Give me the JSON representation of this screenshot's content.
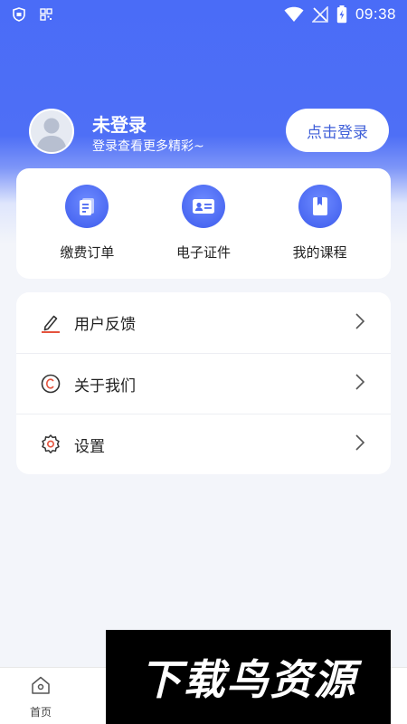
{
  "status_bar": {
    "time": "09:38",
    "icons": [
      "shield-icon",
      "qr-icon",
      "wifi-icon",
      "no-signal-icon",
      "battery-charging-icon"
    ]
  },
  "profile": {
    "name": "未登录",
    "subtitle": "登录查看更多精彩~",
    "login_button": "点击登录"
  },
  "quick_actions": [
    {
      "label": "缴费订单",
      "icon": "order-document-icon"
    },
    {
      "label": "电子证件",
      "icon": "id-card-icon"
    },
    {
      "label": "我的课程",
      "icon": "course-book-icon"
    }
  ],
  "menu": [
    {
      "label": "用户反馈",
      "icon": "edit-pen-icon"
    },
    {
      "label": "关于我们",
      "icon": "copyright-icon"
    },
    {
      "label": "设置",
      "icon": "settings-gear-icon"
    }
  ],
  "tabbar": {
    "home_label": "首页"
  },
  "watermark": {
    "text": "下载鸟资源"
  },
  "colors": {
    "primary": "#4a6cf7",
    "background": "#f3f5fa",
    "card": "#ffffff",
    "text": "#222222"
  }
}
